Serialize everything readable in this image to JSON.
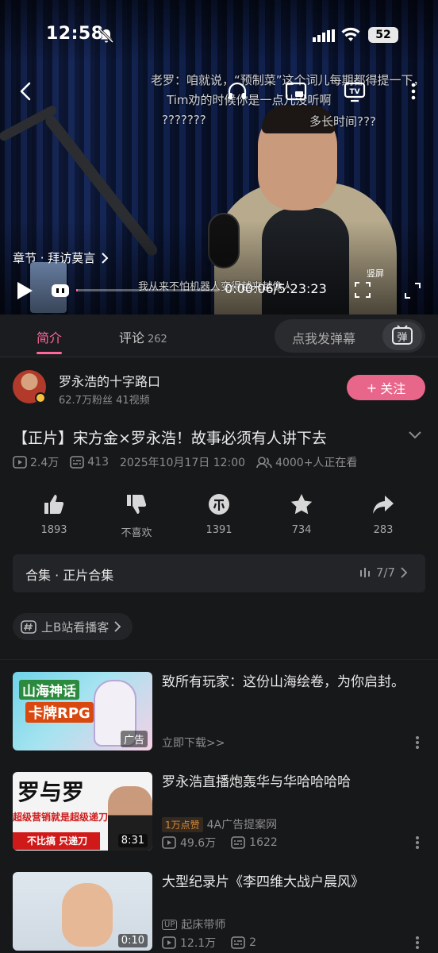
{
  "status_bar": {
    "time": "12:58",
    "battery": "52"
  },
  "player": {
    "danmaku": [
      "老罗：咱就说，“预制菜”这个词儿每期都得提一下，",
      "Tim劝的时候你是一点儿没听啊",
      "???????",
      "多长时间???",
      "我从来不怕机器人变得越来越像人"
    ],
    "chapter": "章节 · 拜访莫言",
    "time": "0:00:06/5:23:23",
    "portrait_label": "竖屏"
  },
  "tabs": {
    "intro": "简介",
    "comments": "评论",
    "comments_count": "262",
    "danmaku_placeholder": "点我发弹幕",
    "danmaku_btn": "弹"
  },
  "uploader": {
    "name": "罗永浩的十字路口",
    "stats": "62.7万粉丝  41视频",
    "follow": "关注"
  },
  "video": {
    "title": "【正片】宋方金×罗永浩！故事必须有人讲下去",
    "views": "2.4万",
    "danmaku_count": "413",
    "date": "2025年10月17日 12:00",
    "watching": "4000+人正在看"
  },
  "actions": [
    {
      "name": "like",
      "value": "1893"
    },
    {
      "name": "dislike",
      "value": "不喜欢"
    },
    {
      "name": "coin",
      "value": "1391"
    },
    {
      "name": "favorite",
      "value": "734"
    },
    {
      "name": "share",
      "value": "283"
    }
  ],
  "collection": {
    "label": "合集 · 正片合集",
    "count": "7/7"
  },
  "podcast": {
    "label": "上B站看播客"
  },
  "recommendations": [
    {
      "title": "致所有玩家：这份山海绘卷，为你启封。",
      "meta": "立即下载>>",
      "badge": "广告",
      "thumb_text1": "山海神话",
      "thumb_text2": "卡牌RPG"
    },
    {
      "title": "罗永浩直播炮轰华与华哈哈哈哈",
      "hot": "1万点赞",
      "source": "4A广告提案网",
      "views": "49.6万",
      "danmaku": "1622",
      "duration": "8:31",
      "thumb_text1": "罗与罗",
      "thumb_text2": "超级营销就是超级递刀",
      "thumb_text3": "不比搞 只递刀"
    },
    {
      "title": "大型纪录片《李四维大战户晨风》",
      "up": "起床带师",
      "views": "12.1万",
      "danmaku": "2",
      "duration": "0:10"
    }
  ],
  "colors": {
    "accent": "#ff6699",
    "follow_bg": "#e8668a"
  }
}
